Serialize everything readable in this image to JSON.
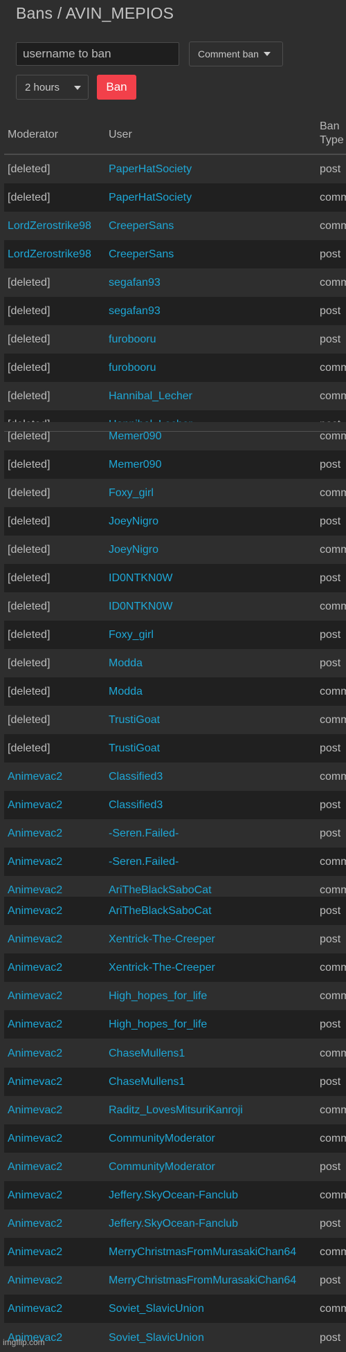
{
  "header": {
    "title": "Bans / AVIN_MEPIOS"
  },
  "form": {
    "username_placeholder": "username to ban",
    "username_value": "",
    "ban_type_selected": "Comment ban",
    "duration_selected": "2 hours",
    "ban_button": "Ban",
    "ban_button_color": "#f2404a"
  },
  "table": {
    "columns": {
      "moderator": "Moderator",
      "user": "User",
      "ban_type": "Ban Type"
    },
    "link_color": "#1ea7d6",
    "rows": [
      {
        "moderator": "[deleted]",
        "user": "PaperHatSociety",
        "type": "post"
      },
      {
        "moderator": "[deleted]",
        "user": "PaperHatSociety",
        "type": "comm"
      },
      {
        "moderator": "LordZerostrike98",
        "user": "CreeperSans",
        "type": "comm"
      },
      {
        "moderator": "LordZerostrike98",
        "user": "CreeperSans",
        "type": "post"
      },
      {
        "moderator": "[deleted]",
        "user": "segafan93",
        "type": "comm"
      },
      {
        "moderator": "[deleted]",
        "user": "segafan93",
        "type": "post"
      },
      {
        "moderator": "[deleted]",
        "user": "furobooru",
        "type": "post"
      },
      {
        "moderator": "[deleted]",
        "user": "furobooru",
        "type": "comm"
      },
      {
        "moderator": "[deleted]",
        "user": "Hannibal_Lecher",
        "type": "comm"
      },
      {
        "moderator": "[deleted]",
        "user": "Hannibal_Lecher",
        "type": "post"
      },
      {
        "moderator": "[deleted]",
        "user": "Memer090",
        "type": "comm"
      },
      {
        "moderator": "[deleted]",
        "user": "Memer090",
        "type": "post"
      },
      {
        "moderator": "[deleted]",
        "user": "Foxy_girl",
        "type": "comm"
      },
      {
        "moderator": "[deleted]",
        "user": "JoeyNigro",
        "type": "post"
      },
      {
        "moderator": "[deleted]",
        "user": "JoeyNigro",
        "type": "comm"
      },
      {
        "moderator": "[deleted]",
        "user": "ID0NTKN0W",
        "type": "post"
      },
      {
        "moderator": "[deleted]",
        "user": "ID0NTKN0W",
        "type": "comm"
      },
      {
        "moderator": "[deleted]",
        "user": "Foxy_girl",
        "type": "post"
      },
      {
        "moderator": "[deleted]",
        "user": "Modda",
        "type": "post"
      },
      {
        "moderator": "[deleted]",
        "user": "Modda",
        "type": "comm"
      },
      {
        "moderator": "[deleted]",
        "user": "TrustiGoat",
        "type": "comm"
      },
      {
        "moderator": "[deleted]",
        "user": "TrustiGoat",
        "type": "post"
      },
      {
        "moderator": "Animevac2",
        "user": "Classified3",
        "type": "comm"
      },
      {
        "moderator": "Animevac2",
        "user": "Classified3",
        "type": "post"
      },
      {
        "moderator": "Animevac2",
        "user": "-Seren.Failed-",
        "type": "post"
      },
      {
        "moderator": "Animevac2",
        "user": "-Seren.Failed-",
        "type": "comm"
      },
      {
        "moderator": "Animevac2",
        "user": "AriTheBlackSaboCat",
        "type": "comm"
      },
      {
        "moderator": "Animevac2",
        "user": "AriTheBlackSaboCat",
        "type": "post"
      },
      {
        "moderator": "Animevac2",
        "user": "Xentrick-The-Creeper",
        "type": "post"
      },
      {
        "moderator": "Animevac2",
        "user": "Xentrick-The-Creeper",
        "type": "comm"
      },
      {
        "moderator": "Animevac2",
        "user": "High_hopes_for_life",
        "type": "comm"
      },
      {
        "moderator": "Animevac2",
        "user": "High_hopes_for_life",
        "type": "post"
      },
      {
        "moderator": "Animevac2",
        "user": "ChaseMullens1",
        "type": "comm"
      },
      {
        "moderator": "Animevac2",
        "user": "ChaseMullens1",
        "type": "post"
      },
      {
        "moderator": "Animevac2",
        "user": "Raditz_LovesMitsuriKanroji",
        "type": "comm"
      },
      {
        "moderator": "Animevac2",
        "user": "CommunityModerator",
        "type": "comm"
      },
      {
        "moderator": "Animevac2",
        "user": "CommunityModerator",
        "type": "post"
      },
      {
        "moderator": "Animevac2",
        "user": "Jeffery.SkyOcean-Fanclub",
        "type": "comm"
      },
      {
        "moderator": "Animevac2",
        "user": "Jeffery.SkyOcean-Fanclub",
        "type": "post"
      },
      {
        "moderator": "Animevac2",
        "user": "MerryChristmasFromMurasakiChan64",
        "type": "comm"
      },
      {
        "moderator": "Animevac2",
        "user": "MerryChristmasFromMurasakiChan64",
        "type": "post"
      },
      {
        "moderator": "Animevac2",
        "user": "Soviet_SlavicUnion",
        "type": "comm"
      },
      {
        "moderator": "Animevac2",
        "user": "Soviet_SlavicUnion",
        "type": "post"
      }
    ]
  },
  "watermark": "imgflip.com"
}
